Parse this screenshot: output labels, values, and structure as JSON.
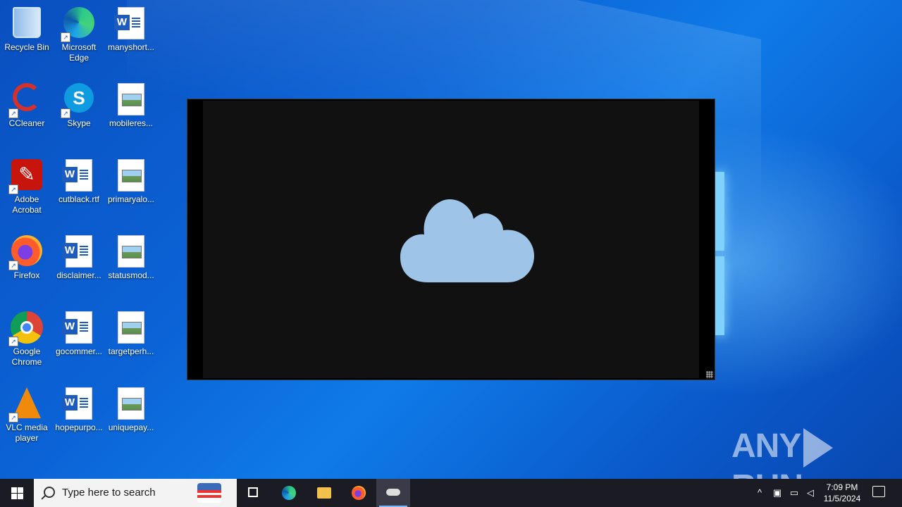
{
  "desktop": {
    "icons": [
      {
        "label": "Recycle Bin"
      },
      {
        "label": "Microsoft Edge"
      },
      {
        "label": "manyshort..."
      },
      {
        "label": "CCleaner"
      },
      {
        "label": "Skype"
      },
      {
        "label": "mobileres..."
      },
      {
        "label": "Adobe Acrobat"
      },
      {
        "label": "cutblack.rtf"
      },
      {
        "label": "primaryalo..."
      },
      {
        "label": "Firefox"
      },
      {
        "label": "disclaimer..."
      },
      {
        "label": "statusmod..."
      },
      {
        "label": "Google Chrome"
      },
      {
        "label": "gocommer..."
      },
      {
        "label": "targetperh..."
      },
      {
        "label": "VLC media player"
      },
      {
        "label": "hopepurpo..."
      },
      {
        "label": "uniquepay..."
      }
    ]
  },
  "window": {
    "icon": "cloud-icon",
    "cloud_color": "#9ec5e8",
    "background": "#111111"
  },
  "watermark": {
    "left": "ANY",
    "right": "RUN"
  },
  "taskbar": {
    "search_placeholder": "Type here to search",
    "time": "7:09 PM",
    "date": "11/5/2024",
    "background": "#1b1b24"
  }
}
